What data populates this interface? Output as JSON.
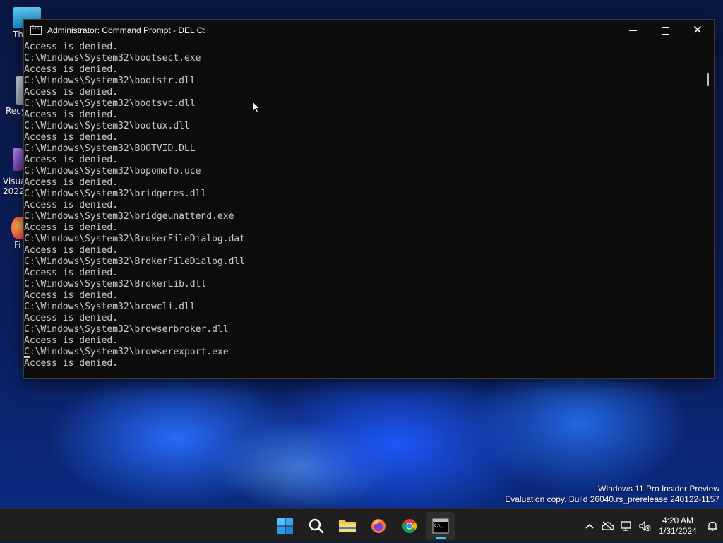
{
  "window": {
    "title": "Administrator: Command Prompt - DEL  C:",
    "controls": {
      "minimize": "minimize",
      "maximize": "maximize",
      "close": "✕"
    }
  },
  "console": {
    "lines": [
      "Access is denied.",
      "C:\\Windows\\System32\\bootsect.exe",
      "Access is denied.",
      "C:\\Windows\\System32\\bootstr.dll",
      "Access is denied.",
      "C:\\Windows\\System32\\bootsvc.dll",
      "Access is denied.",
      "C:\\Windows\\System32\\bootux.dll",
      "Access is denied.",
      "C:\\Windows\\System32\\BOOTVID.DLL",
      "Access is denied.",
      "C:\\Windows\\System32\\bopomofo.uce",
      "Access is denied.",
      "C:\\Windows\\System32\\bridgeres.dll",
      "Access is denied.",
      "C:\\Windows\\System32\\bridgeunattend.exe",
      "Access is denied.",
      "C:\\Windows\\System32\\BrokerFileDialog.dat",
      "Access is denied.",
      "C:\\Windows\\System32\\BrokerFileDialog.dll",
      "Access is denied.",
      "C:\\Windows\\System32\\BrokerLib.dll",
      "Access is denied.",
      "C:\\Windows\\System32\\browcli.dll",
      "Access is denied.",
      "C:\\Windows\\System32\\browserbroker.dll",
      "Access is denied.",
      "C:\\Windows\\System32\\browserexport.exe",
      "Access is denied."
    ]
  },
  "desktop": {
    "icons": [
      {
        "label": "Th",
        "icon": "this-pc-icon"
      },
      {
        "label": "Recy",
        "icon": "recycle-bin-icon"
      },
      {
        "label": "Visua",
        "label2": "2022",
        "icon": "visual-studio-icon"
      },
      {
        "label": "Fi",
        "icon": "firefox-icon"
      }
    ]
  },
  "watermark": {
    "line1": "Windows 11 Pro Insider Preview",
    "line2": "Evaluation copy. Build 26040.rs_prerelease.240122-1157"
  },
  "taskbar": {
    "apps": [
      "start-icon",
      "search-icon",
      "file-explorer-icon",
      "firefox-icon",
      "chrome-icon",
      "terminal-icon"
    ],
    "clock": {
      "time": "4:20 AM",
      "date": "1/31/2024"
    }
  },
  "colors": {
    "console_bg": "#0c0c0c",
    "console_fg": "#cccccc",
    "accent": "#4cc2ff",
    "taskbar_bg": "#1f1f1f"
  }
}
